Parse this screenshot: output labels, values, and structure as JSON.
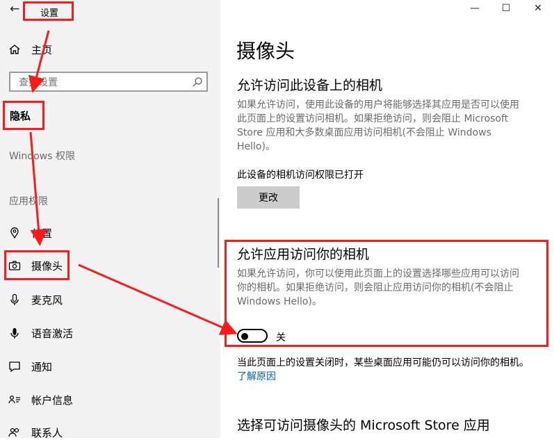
{
  "window": {
    "title": "设置",
    "back_glyph": "←",
    "controls": {
      "minimize": "—",
      "maximize": "☐",
      "close": "✕"
    }
  },
  "sidebar": {
    "home_label": "主页",
    "search_placeholder": "查找设置",
    "privacy_label": "隐私",
    "windows_permissions_header": "Windows 权限",
    "app_permissions_header": "应用权限",
    "items": [
      {
        "label": "位置",
        "icon": "location-icon"
      },
      {
        "label": "摄像头",
        "icon": "camera-icon"
      },
      {
        "label": "麦克风",
        "icon": "microphone-icon"
      },
      {
        "label": "语音激活",
        "icon": "voice-activation-icon"
      },
      {
        "label": "通知",
        "icon": "notification-icon"
      },
      {
        "label": "帐户信息",
        "icon": "account-info-icon"
      },
      {
        "label": "联系人",
        "icon": "contacts-icon"
      }
    ]
  },
  "main": {
    "title": "摄像头",
    "device_section": {
      "heading": "允许访问此设备上的相机",
      "description_lines": [
        "如果允许访问，使用此设备的用户将能够选择其应用是否可以使用",
        "此页面上的设置访问相机。如果拒绝访问，则会阻止 Microsoft",
        "Store 应用和大多数桌面应用访问相机(不会阻止 Windows",
        "Hello)。"
      ],
      "status": "此设备的相机访问权限已打开",
      "change_button": "更改"
    },
    "app_section": {
      "heading": "允许应用访问你的相机",
      "description_lines": [
        "如果允许访问，你可以使用此页面上的设置选择哪些应用可以访问",
        "你的相机。如果拒绝访问，则会阻止应用访问你的相机(不会阻止",
        "Windows Hello)。"
      ],
      "toggle_label": "关",
      "toggle_on": false
    },
    "note": {
      "text": "当此页面上的设置关闭时，某些桌面应用可能仍可以访问你的相机。",
      "link": "了解原因"
    },
    "store_section_heading": "选择可访问摄像头的 Microsoft Store 应用"
  },
  "colors": {
    "annotation_red": "#ff1a1a",
    "sidebar_bg": "#f2f2f2",
    "link_blue": "#0063b1",
    "button_gray": "#cccccc"
  }
}
